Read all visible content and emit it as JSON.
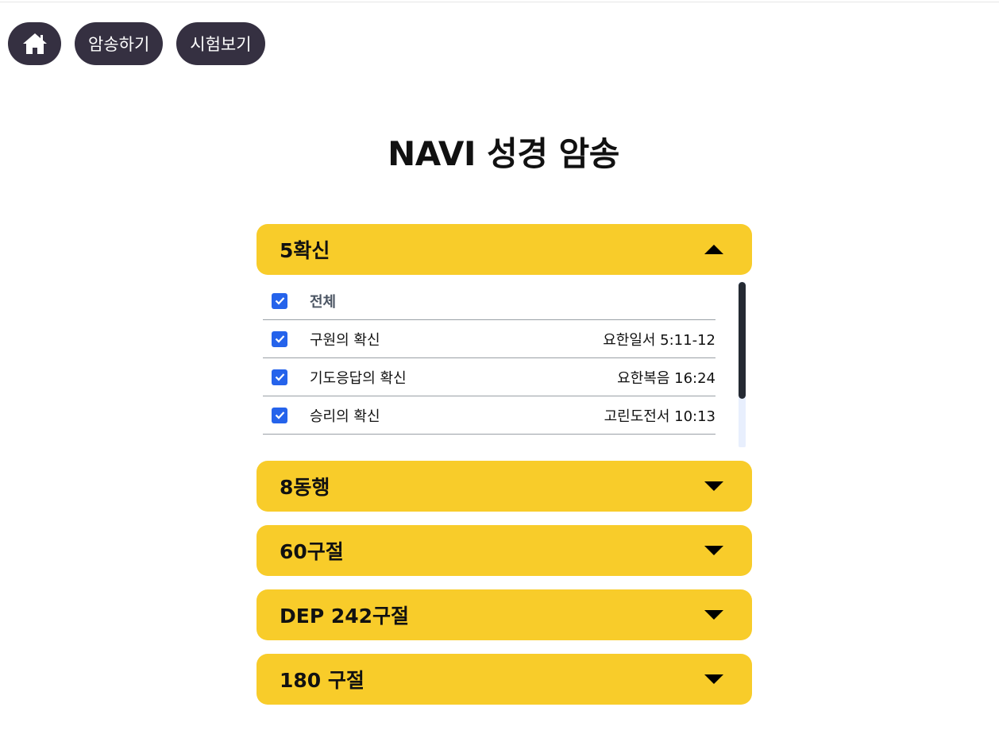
{
  "nav": {
    "home_icon": "home-icon",
    "memorize_label": "암송하기",
    "test_label": "시험보기"
  },
  "page_title": "NAVI 성경 암송",
  "sections": [
    {
      "title": "5확신",
      "expanded": true,
      "select_all_label": "전체",
      "items": [
        {
          "label": "구원의 확신",
          "ref": "요한일서 5:11-12",
          "checked": true
        },
        {
          "label": "기도응답의 확신",
          "ref": "요한복음 16:24",
          "checked": true
        },
        {
          "label": "승리의 확신",
          "ref": "고린도전서 10:13",
          "checked": true
        }
      ]
    },
    {
      "title": "8동행",
      "expanded": false
    },
    {
      "title": "60구절",
      "expanded": false
    },
    {
      "title": "DEP 242구절",
      "expanded": false
    },
    {
      "title": "180 구절",
      "expanded": false
    }
  ],
  "colors": {
    "accordion_bg": "#f8cc2a",
    "nav_button_bg": "#353041",
    "checkbox": "#2563eb"
  }
}
